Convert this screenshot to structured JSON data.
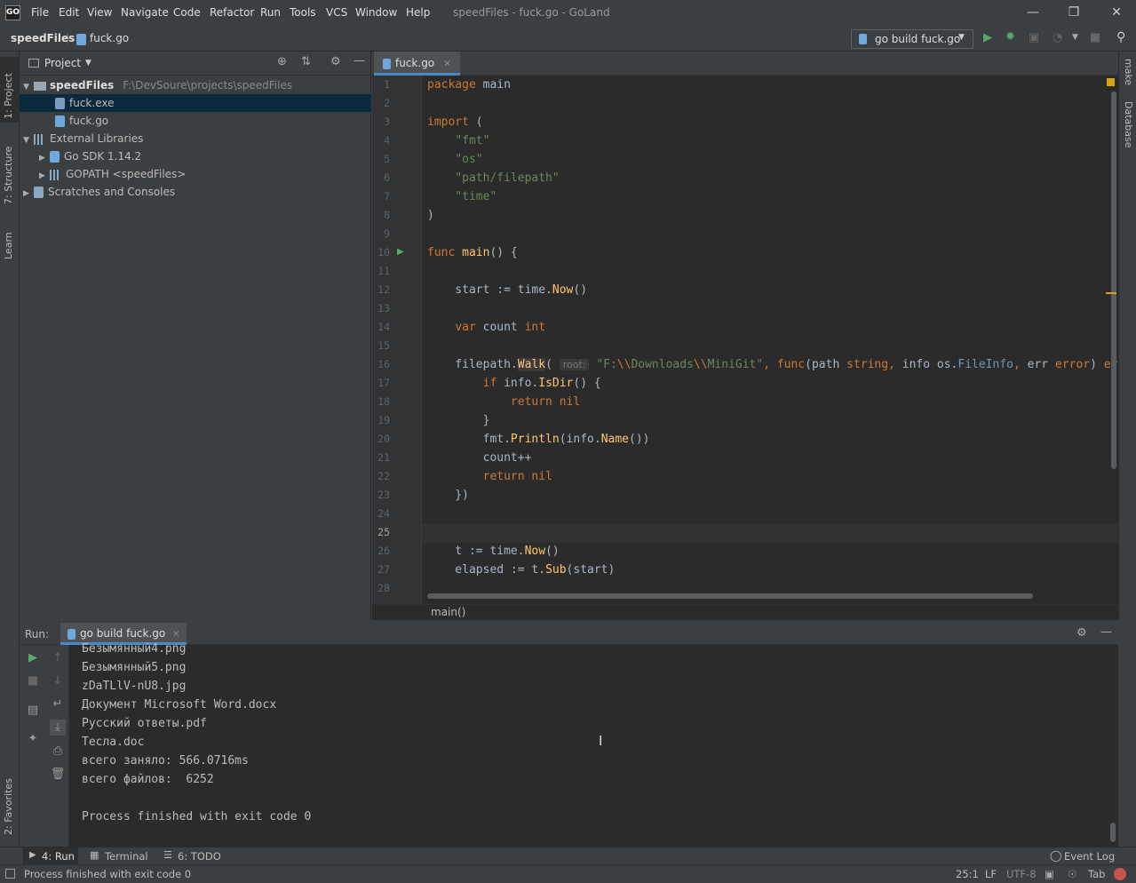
{
  "app": {
    "logo": "GO",
    "window_title": "speedFiles - fuck.go - GoLand",
    "menu": [
      "File",
      "Edit",
      "View",
      "Navigate",
      "Code",
      "Refactor",
      "Run",
      "Tools",
      "VCS",
      "Window",
      "Help"
    ],
    "window_controls": [
      "minimize-icon",
      "restore-icon",
      "close-icon"
    ]
  },
  "navbar": {
    "project": "speedFiles",
    "file": "fuck.go",
    "run_config": "go build fuck.go"
  },
  "left_strip": [
    "1: Project",
    "7: Structure",
    "Learn",
    "2: Favorites"
  ],
  "right_strip": [
    "make",
    "Database"
  ],
  "project_panel": {
    "title": "Project",
    "tree": [
      {
        "label": "speedFiles",
        "path": "F:\\DevSoure\\projects\\speedFiles",
        "level": 0,
        "icon": "folder-icon",
        "expanded": "▼"
      },
      {
        "label": "fuck.exe",
        "level": 1,
        "icon": "file-icon",
        "selected": true
      },
      {
        "label": "fuck.go",
        "level": 1,
        "icon": "go-file-icon"
      },
      {
        "label": "External Libraries",
        "level": 0,
        "icon": "library-icon",
        "expanded": "▼"
      },
      {
        "label": "Go SDK 1.14.2",
        "level": 1,
        "icon": "go-sdk-icon",
        "expanded": "▶"
      },
      {
        "label": "GOPATH <speedFiles>",
        "level": 1,
        "icon": "library-icon",
        "expanded": "▶"
      },
      {
        "label": "Scratches and Consoles",
        "level": 0,
        "icon": "scratches-icon",
        "expanded": "▶"
      }
    ]
  },
  "editor": {
    "tab": "fuck.go",
    "line_numbers": [
      "1",
      "2",
      "3",
      "4",
      "5",
      "6",
      "7",
      "8",
      "9",
      "10",
      "11",
      "12",
      "13",
      "14",
      "15",
      "16",
      "17",
      "18",
      "19",
      "20",
      "21",
      "22",
      "23",
      "24",
      "25",
      "26",
      "27",
      "28"
    ],
    "param_hint": "root:",
    "breadcrumb": "main()"
  },
  "run_panel": {
    "label": "Run:",
    "tab": "go build fuck.go",
    "output": [
      "Безымянный4.png",
      "Безымянный5.png",
      "zDaTLlV-nU8.jpg",
      "Документ Microsoft Word.docx",
      "Русский ответы.pdf",
      "Тесла.doc",
      "всего заняло: 566.0716ms",
      "всего файлов:  6252",
      "",
      "Process finished with exit code 0"
    ]
  },
  "bottom_tabs": [
    "4: Run",
    "Terminal",
    "6: TODO"
  ],
  "event_log": "Event Log",
  "status": {
    "message": "Process finished with exit code 0",
    "position": "25:1",
    "line_sep": "LF",
    "encoding": "UTF-8",
    "indent": "Tab"
  }
}
